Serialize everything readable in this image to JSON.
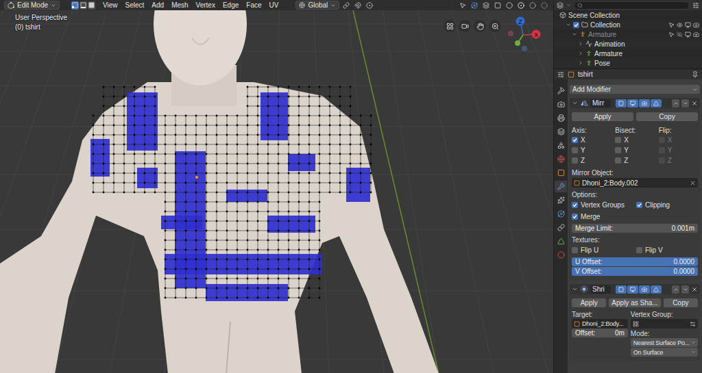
{
  "viewport": {
    "mode": "Edit Mode",
    "select_modes": [
      {
        "selected": true
      },
      {
        "selected": false
      },
      {
        "selected": false
      }
    ],
    "menus": [
      "View",
      "Select",
      "Add",
      "Mesh",
      "Vertex",
      "Edge",
      "Face",
      "UV"
    ],
    "orientation": "Global",
    "overlay": {
      "view": "User Perspective",
      "object": "(0) tshirt"
    },
    "gizmo": [
      {
        "label": "Z",
        "color": "#2e6bd6"
      },
      {
        "label": "X",
        "color": "#d9343f"
      }
    ]
  },
  "outliner": {
    "items": [
      {
        "label": "Scene Collection",
        "expanded": true,
        "disabled": false,
        "children": [
          {
            "label": "Collection",
            "expanded": true,
            "disabled": false,
            "checked": true,
            "visible": true,
            "children": [
              {
                "label": "Armature",
                "expanded": true,
                "disabled": true,
                "visible": false,
                "children": [
                  {
                    "label": "Animation",
                    "expanded": false,
                    "disabled": false,
                    "children": []
                  },
                  {
                    "label": "Armature",
                    "expanded": false,
                    "disabled": false,
                    "children": []
                  },
                  {
                    "label": "Pose",
                    "expanded": false,
                    "disabled": false,
                    "children": []
                  }
                ]
              }
            ]
          }
        ]
      }
    ]
  },
  "properties": {
    "object": "tshirt",
    "tabs": [
      {
        "selected": false
      },
      {
        "selected": false
      },
      {
        "selected": false
      },
      {
        "selected": false
      },
      {
        "selected": false
      },
      {
        "selected": false
      },
      {
        "selected": false
      },
      {
        "selected": true
      },
      {
        "selected": false
      },
      {
        "selected": false
      },
      {
        "selected": false
      },
      {
        "selected": false
      },
      {
        "selected": false
      }
    ],
    "add_modifier": "Add Modifier",
    "mirror": {
      "name": "Mirr",
      "expanded": true,
      "toggles": [
        {
          "on": true
        },
        {
          "on": true
        },
        {
          "on": true
        },
        {
          "on": true
        }
      ],
      "buttons": [
        "Apply",
        "Copy"
      ],
      "axis_groups": [
        {
          "label": "Axis:",
          "options": [
            {
              "label": "X",
              "checked": true,
              "disabled": false
            },
            {
              "label": "Y",
              "checked": false,
              "disabled": false
            },
            {
              "label": "Z",
              "checked": false,
              "disabled": false
            }
          ]
        },
        {
          "label": "Bisect:",
          "options": [
            {
              "label": "X",
              "checked": false,
              "disabled": false
            },
            {
              "label": "Y",
              "checked": false,
              "disabled": false
            },
            {
              "label": "Z",
              "checked": false,
              "disabled": false
            }
          ]
        },
        {
          "label": "Flip:",
          "options": [
            {
              "label": "X",
              "checked": false,
              "disabled": true
            },
            {
              "label": "Y",
              "checked": false,
              "disabled": true
            },
            {
              "label": "Z",
              "checked": false,
              "disabled": true
            }
          ]
        }
      ],
      "mirror_object": {
        "label": "Mirror Object:",
        "value": "Dhoni_2:Body.002"
      },
      "options_label": "Options:",
      "options": [
        {
          "label": "Vertex Groups",
          "checked": true
        },
        {
          "label": "Clipping",
          "checked": true
        },
        {
          "label": "Merge",
          "checked": true
        }
      ],
      "merge_limit": {
        "label": "Merge Limit:",
        "value": "0.001m"
      },
      "textures_label": "Textures:",
      "flips": [
        {
          "label": "Flip U",
          "checked": false
        },
        {
          "label": "Flip V",
          "checked": false
        }
      ],
      "offsets": [
        {
          "label": "U Offset:",
          "value": "0.0000"
        },
        {
          "label": "V Offset:",
          "value": "0.0000"
        }
      ]
    },
    "shrinkwrap": {
      "name": "Shri",
      "expanded": true,
      "toggles": [
        {
          "on": true
        },
        {
          "on": true
        },
        {
          "on": true
        },
        {
          "on": true
        }
      ],
      "buttons": [
        "Apply",
        "Apply as Sha...",
        "Copy"
      ],
      "target": {
        "label": "Target:",
        "value": "Dhoni_2:Body..."
      },
      "offset": {
        "label": "Offset:",
        "value": "0m"
      },
      "vertex_group": {
        "label": "Vertex Group:",
        "value": ""
      },
      "mode": {
        "label": "Mode:",
        "values": [
          "Nearest Surface Po...",
          "On Surface"
        ]
      }
    }
  }
}
